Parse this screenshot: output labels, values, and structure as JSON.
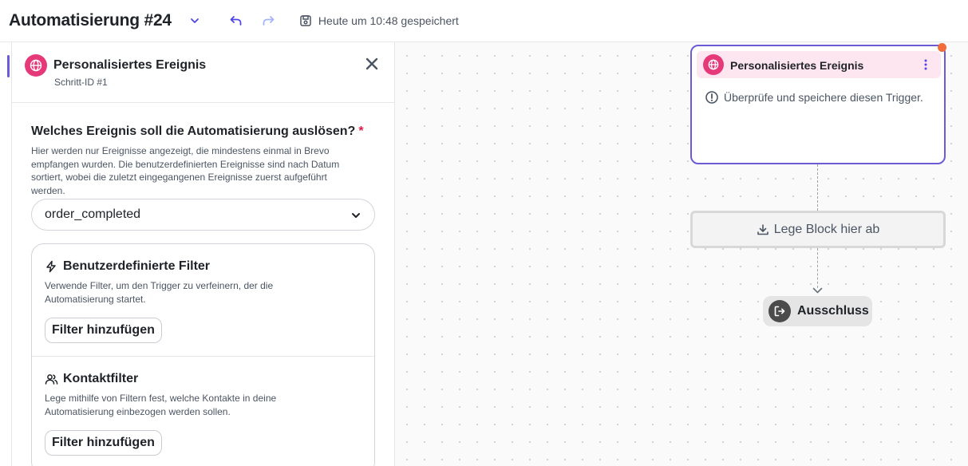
{
  "header": {
    "title": "Automatisierung #24",
    "save_status": "Heute um 10:48 gespeichert"
  },
  "panel": {
    "title": "Personalisiertes Ereignis",
    "step_id": "Schritt-ID #1",
    "question": "Welches Ereignis soll die Automatisierung auslösen?",
    "required_mark": "*",
    "help_text": "Hier werden nur Ereignisse angezeigt, die mindestens einmal in Brevo empfangen wurden. Die benutzerdefinierten Ereignisse sind nach Datum sortiert, wobei die zuletzt eingegangenen Ereignisse zuerst aufgeführt werden.",
    "selected_event": "order_completed",
    "custom_filters": {
      "title": "Benutzerdefinierte Filter",
      "description": "Verwende Filter, um den Trigger zu verfeinern, der die Automatisierung startet.",
      "button": "Filter hinzufügen"
    },
    "contact_filters": {
      "title": "Kontaktfilter",
      "description": "Lege mithilfe von Filtern fest, welche Kontakte in deine Automatisierung einbezogen werden sollen.",
      "button": "Filter hinzufügen"
    }
  },
  "canvas": {
    "trigger_node": {
      "title": "Personalisiertes Ereignis",
      "message": "Überprüfe und speichere diesen Trigger."
    },
    "dropzone_label": "Lege Block hier ab",
    "exit_label": "Ausschluss"
  },
  "colors": {
    "accent": "#6b5cd6",
    "brand_pink": "#e6397a",
    "node_header_bg": "#fde6ef",
    "notification_dot": "#f26b3a"
  },
  "icons": [
    "chevron-down-icon",
    "undo-icon",
    "redo-icon",
    "save-icon",
    "globe-icon",
    "close-icon",
    "bolt-icon",
    "users-icon",
    "kebab-menu-icon",
    "warning-icon",
    "download-icon",
    "exit-icon"
  ]
}
